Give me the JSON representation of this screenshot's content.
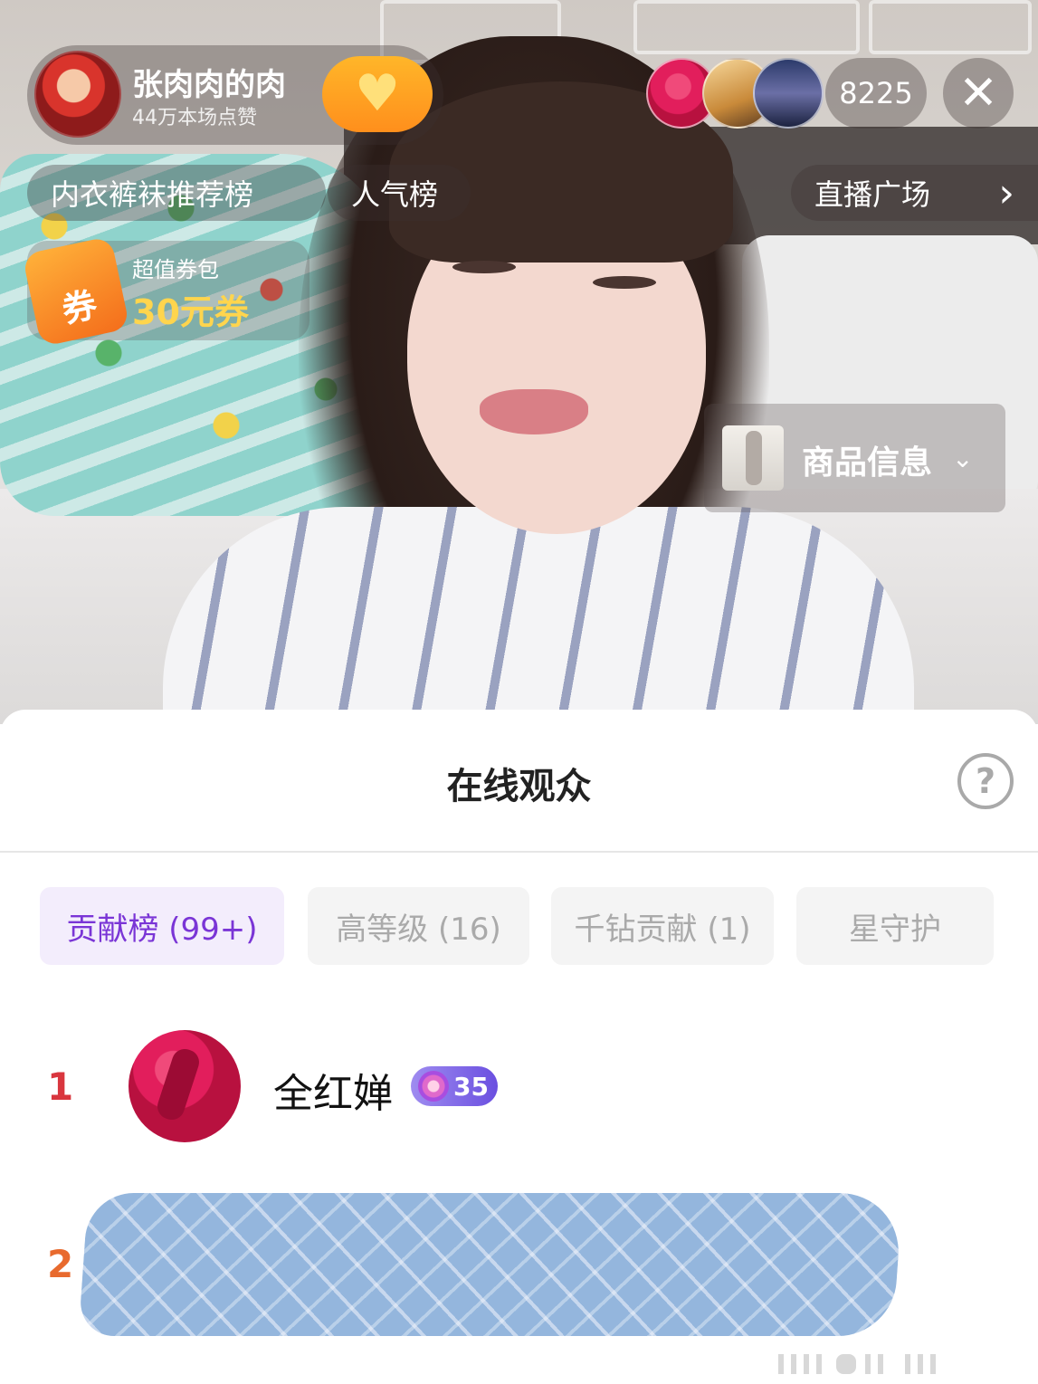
{
  "host": {
    "name": "张肉肉的肉",
    "likes": "44万本场点赞",
    "follow_icon": "heart-plus-icon"
  },
  "viewers": {
    "count": "8225"
  },
  "chips": {
    "ranking": "内衣裤袜推荐榜",
    "popularity": "人气榜",
    "live_square": "直播广场",
    "live_square_chevron": "›"
  },
  "coupon": {
    "icon_text": "券",
    "title": "超值券包",
    "value": "30元券"
  },
  "product": {
    "label": "商品信息",
    "chevron": "⌄"
  },
  "sheet": {
    "title": "在线观众",
    "help": "?",
    "tabs": [
      {
        "label": "贡献榜 (99+)",
        "active": true
      },
      {
        "label": "高等级 (16)",
        "active": false
      },
      {
        "label": "千钻贡献 (1)",
        "active": false
      },
      {
        "label": "星守护",
        "active": false
      }
    ],
    "rows": [
      {
        "rank": "1",
        "name": "全红婵",
        "level": "35"
      },
      {
        "rank": "2",
        "name": ""
      }
    ]
  },
  "colors": {
    "accent_purple": "#7a35d6",
    "rank1": "#d9363e",
    "rank2": "#e86a2e",
    "follow_orange": "#ff9e22",
    "coupon_yellow": "#ffd54d"
  }
}
